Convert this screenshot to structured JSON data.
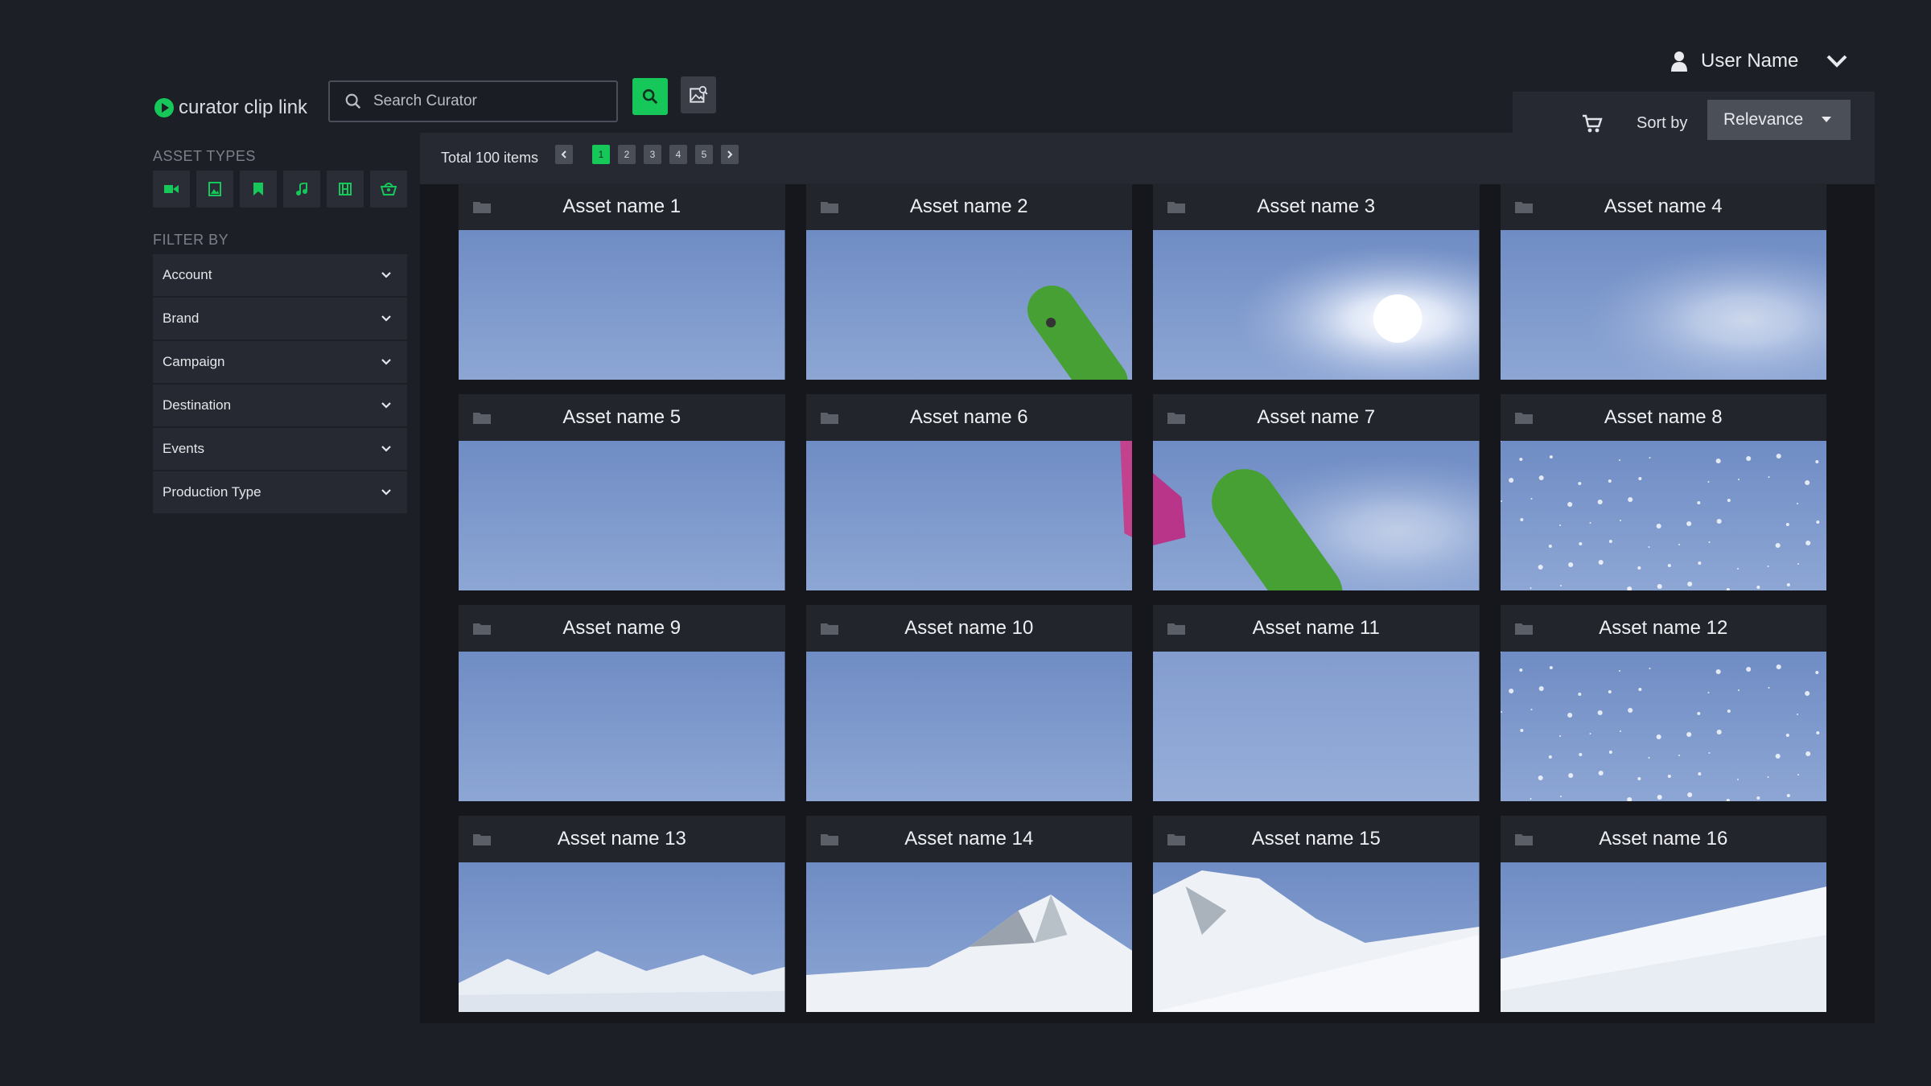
{
  "app": {
    "name": "curator clip link"
  },
  "search": {
    "placeholder": "Search Curator"
  },
  "user": {
    "name": "User Name"
  },
  "sidebar": {
    "asset_types_label": "ASSET TYPES",
    "asset_types": [
      {
        "icon": "video-icon"
      },
      {
        "icon": "image-icon"
      },
      {
        "icon": "bookmark-icon"
      },
      {
        "icon": "music-icon"
      },
      {
        "icon": "film-icon"
      },
      {
        "icon": "basket-icon"
      }
    ],
    "filter_label": "FILTER BY",
    "filters": [
      "Account",
      "Brand",
      "Campaign",
      "Destination",
      "Events",
      "Production Type"
    ]
  },
  "toolbar": {
    "total": "Total 100 items",
    "pages": [
      "1",
      "2",
      "3",
      "4",
      "5"
    ],
    "sort_label": "Sort by",
    "sort_value": "Relevance"
  },
  "assets": [
    {
      "name": "Asset name 1",
      "scene": "sky"
    },
    {
      "name": "Asset name 2",
      "scene": "sky-board"
    },
    {
      "name": "Asset name 3",
      "scene": "sun"
    },
    {
      "name": "Asset name 4",
      "scene": "sky-glow"
    },
    {
      "name": "Asset name 5",
      "scene": "sky"
    },
    {
      "name": "Asset name 6",
      "scene": "sky-rider"
    },
    {
      "name": "Asset name 7",
      "scene": "board"
    },
    {
      "name": "Asset name 8",
      "scene": "snowflakes"
    },
    {
      "name": "Asset name 9",
      "scene": "sky"
    },
    {
      "name": "Asset name 10",
      "scene": "sky"
    },
    {
      "name": "Asset name 11",
      "scene": "sky-light"
    },
    {
      "name": "Asset name 12",
      "scene": "snowflakes"
    },
    {
      "name": "Asset name 13",
      "scene": "mountains-low"
    },
    {
      "name": "Asset name 14",
      "scene": "mountain-peak"
    },
    {
      "name": "Asset name 15",
      "scene": "mountain-slope"
    },
    {
      "name": "Asset name 16",
      "scene": "snow-slope"
    }
  ],
  "colors": {
    "accent": "#16c75a",
    "background": "#1d1f27",
    "panel": "#262931"
  }
}
